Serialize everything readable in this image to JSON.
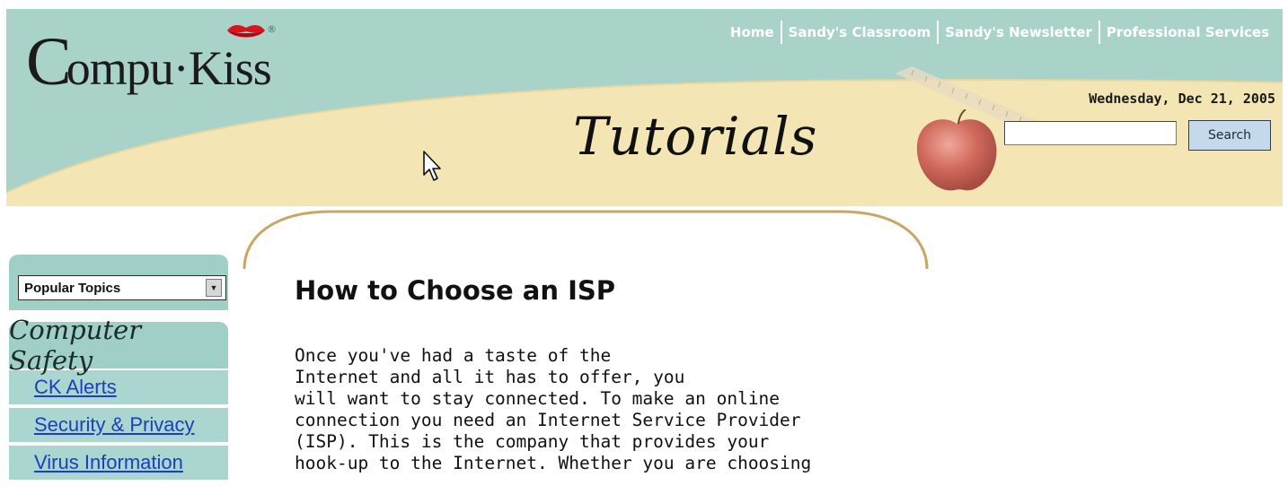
{
  "header": {
    "logo_c": "C",
    "logo_rest": "ompu·Kiss",
    "logo_reg": "®",
    "nav": [
      {
        "label": "Home"
      },
      {
        "label": "Sandy's Classroom"
      },
      {
        "label": "Sandy's Newsletter"
      },
      {
        "label": "Professional Services"
      }
    ],
    "date": "Wednesday, Dec 21, 2005",
    "page_title": "Tutorials",
    "search": {
      "value": "",
      "button_label": "Search"
    }
  },
  "sidebar": {
    "topics_select": "Popular Topics",
    "section_title": "Computer Safety",
    "links": [
      {
        "label": "CK Alerts"
      },
      {
        "label": "Security & Privacy"
      },
      {
        "label": "Virus Information"
      }
    ]
  },
  "article": {
    "title": "How to Choose an ISP",
    "lines": [
      "Once you've had a taste of the",
      "Internet and all it has to offer, you",
      "will want to stay connected. To make an online",
      "connection you need an Internet Service Provider",
      "(ISP). This is the company that provides your",
      "hook-up to the Internet. Whether you are choosing"
    ]
  },
  "colors": {
    "header_teal": "#a9d3c9",
    "header_cream": "#f3e6b4",
    "sidebar_teal": "#9fcfc7",
    "link_blue": "#1a3fbf",
    "arc_gold": "#c9a760"
  },
  "icons": {
    "cursor": "mouse-pointer-icon",
    "lips": "lips-icon",
    "apple": "apple-icon",
    "dropdown": "dropdown-arrow-icon"
  }
}
